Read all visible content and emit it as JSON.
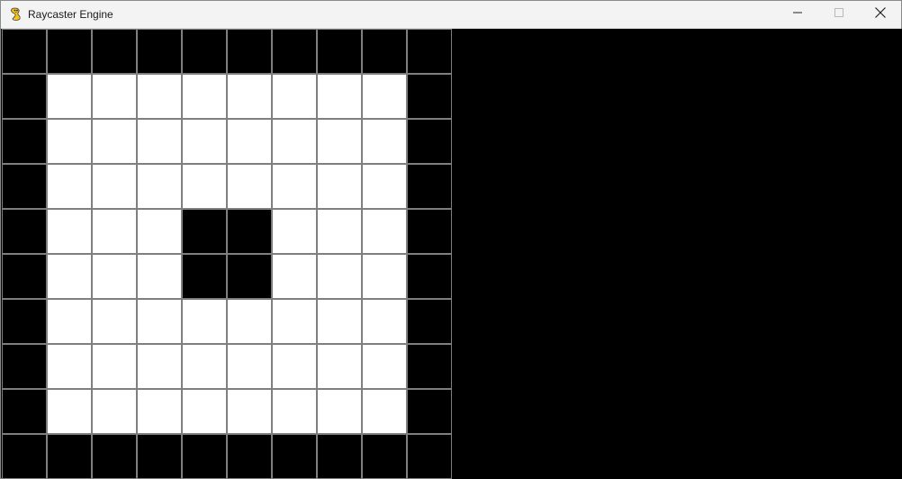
{
  "window": {
    "title": "Raycaster Engine",
    "app_icon": "pygame-snake-icon",
    "controls": [
      "minimize-icon",
      "maximize-icon",
      "close-icon"
    ]
  },
  "map": {
    "wall_color": "#000000",
    "floor_color": "#ffffff",
    "grid_line_color": "#7f7f7f",
    "rows": [
      [
        1,
        1,
        1,
        1,
        1,
        1,
        1,
        1,
        1,
        1
      ],
      [
        1,
        0,
        0,
        0,
        0,
        0,
        0,
        0,
        0,
        1
      ],
      [
        1,
        0,
        0,
        0,
        0,
        0,
        0,
        0,
        0,
        1
      ],
      [
        1,
        0,
        0,
        0,
        0,
        0,
        0,
        0,
        0,
        1
      ],
      [
        1,
        0,
        0,
        0,
        1,
        1,
        0,
        0,
        0,
        1
      ],
      [
        1,
        0,
        0,
        0,
        1,
        1,
        0,
        0,
        0,
        1
      ],
      [
        1,
        0,
        0,
        0,
        0,
        0,
        0,
        0,
        0,
        1
      ],
      [
        1,
        0,
        0,
        0,
        0,
        0,
        0,
        0,
        0,
        1
      ],
      [
        1,
        0,
        0,
        0,
        0,
        0,
        0,
        0,
        0,
        1
      ],
      [
        1,
        1,
        1,
        1,
        1,
        1,
        1,
        1,
        1,
        1
      ]
    ]
  },
  "view3d": {
    "background": "#000000"
  }
}
